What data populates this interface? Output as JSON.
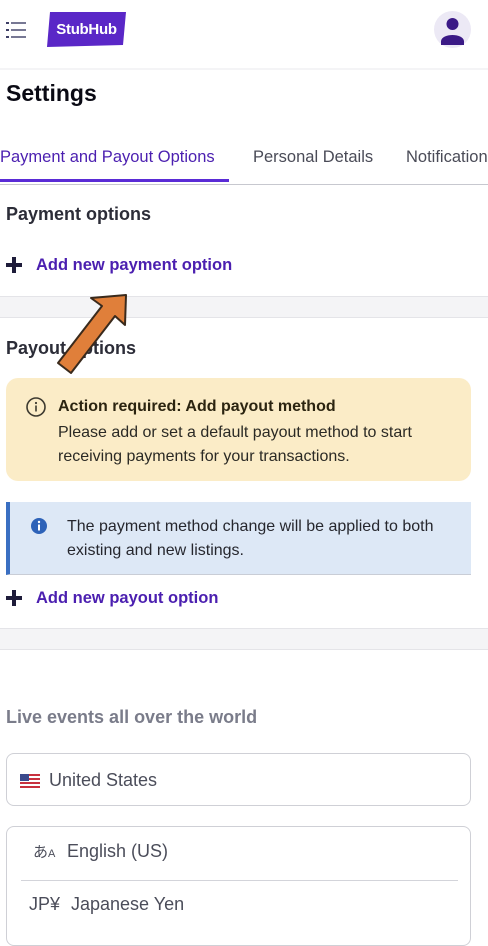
{
  "header": {
    "logo_text": "StubHub",
    "brand_color": "#5a27c7"
  },
  "page": {
    "title": "Settings"
  },
  "tabs": [
    {
      "label": "Payment and Payout Options",
      "active": true
    },
    {
      "label": "Personal Details",
      "active": false
    },
    {
      "label": "Notifications",
      "active": false
    }
  ],
  "payment_options": {
    "title": "Payment options",
    "add_label": "Add new payment option"
  },
  "payout_options": {
    "title": "Payout options",
    "warning_title": "Action required: Add payout method",
    "warning_body": "Please add or set a default payout method to start receiving payments for your transactions.",
    "info_body": "The payment method change will be applied to both existing and new listings.",
    "add_label": "Add new payout option"
  },
  "footer": {
    "title": "Live events all over the world",
    "country": "United States",
    "language": "English (US)",
    "currency_code": "JP¥",
    "currency": "Japanese Yen"
  },
  "colors": {
    "accent": "#4b1fb0",
    "warning_bg": "#fbecc7",
    "info_bg": "#dde8f6",
    "annotation_arrow": "#e07f3a"
  }
}
